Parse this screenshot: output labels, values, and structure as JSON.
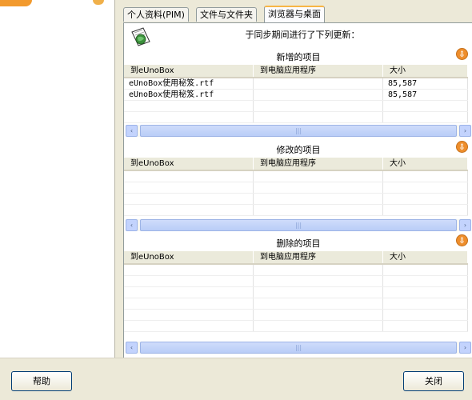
{
  "tabs": [
    {
      "label": "个人资料(PIM)"
    },
    {
      "label": "文件与文件夹"
    },
    {
      "label": "浏览器与桌面"
    }
  ],
  "header": {
    "message": "于同步期间进行了下列更新："
  },
  "sections": {
    "added": {
      "title": "新增的项目",
      "columns": [
        "到eUnoBox",
        "到电脑应用程序",
        "大小"
      ],
      "rows": [
        {
          "to_box": "eUnoBox使用秘笈.rtf",
          "to_pc": "",
          "size": "85,587"
        },
        {
          "to_box": "eUnoBox使用秘笈.rtf",
          "to_pc": "",
          "size": "85,587"
        }
      ]
    },
    "modified": {
      "title": "修改的项目",
      "columns": [
        "到eUnoBox",
        "到电脑应用程序",
        "大小"
      ]
    },
    "deleted": {
      "title": "删除的项目",
      "columns": [
        "到eUnoBox",
        "到电脑应用程序",
        "大小"
      ]
    }
  },
  "scroll": {
    "left_arrow": "‹",
    "right_arrow": "›",
    "grip": "|||"
  },
  "expand_icon": "⇩",
  "buttons": {
    "help": "帮助",
    "close": "关闭"
  },
  "colors": {
    "accent_orange": "#ee8e2c",
    "scroll_blue": "#c3d3fd",
    "tab_highlight": "#f7b545"
  }
}
